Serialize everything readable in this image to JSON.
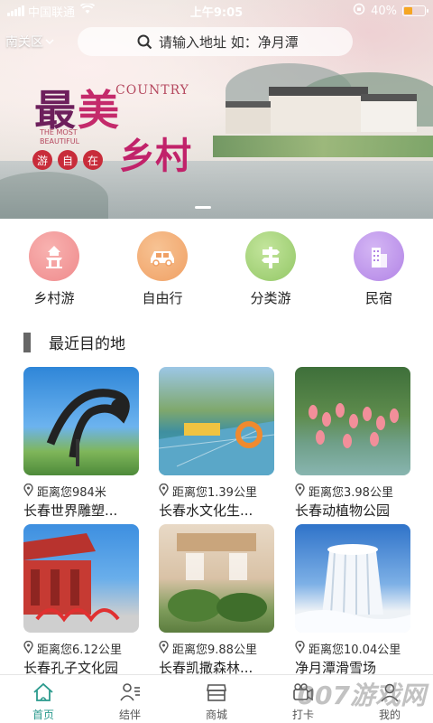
{
  "status_bar": {
    "carrier": "中国联通",
    "time": "上午9:05",
    "battery": "40%",
    "battery_level": 0.4
  },
  "header": {
    "location": "南关区",
    "search_placeholder": "请输入地址 如：净月潭"
  },
  "banner": {
    "title_part1a": "最",
    "title_part1b": "美",
    "title_part2": "乡村",
    "country_text": "COUNTRY",
    "most_beautiful_line1": "THE MOST",
    "most_beautiful_line2": "BEAUTIFUL",
    "seals": [
      "游",
      "自",
      "在"
    ]
  },
  "categories": [
    {
      "label": "乡村游",
      "icon": "temple-icon",
      "color": "#f08a8c"
    },
    {
      "label": "自由行",
      "icon": "car-icon",
      "color": "#f2a56d"
    },
    {
      "label": "分类游",
      "icon": "signpost-icon",
      "color": "#9bd06d"
    },
    {
      "label": "民宿",
      "icon": "building-icon",
      "color": "#b78ae8"
    }
  ],
  "section": {
    "title": "最近目的地"
  },
  "destinations": [
    {
      "distance": "距离您984米",
      "name": "长春世界雕塑..."
    },
    {
      "distance": "距离您1.39公里",
      "name": "长春水文化生..."
    },
    {
      "distance": "距离您3.98公里",
      "name": "长春动植物公园"
    },
    {
      "distance": "距离您6.12公里",
      "name": "长春孔子文化园"
    },
    {
      "distance": "距离您9.88公里",
      "name": "长春凯撒森林..."
    },
    {
      "distance": "距离您10.04公里",
      "name": "净月潭滑雪场"
    }
  ],
  "bottom_nav": [
    {
      "label": "首页",
      "icon": "home-icon",
      "active": true
    },
    {
      "label": "结伴",
      "icon": "companion-icon",
      "active": false
    },
    {
      "label": "商城",
      "icon": "shop-icon",
      "active": false
    },
    {
      "label": "打卡",
      "icon": "camera-icon",
      "active": false
    },
    {
      "label": "我的",
      "icon": "user-icon",
      "active": false
    }
  ],
  "watermark": "007游戏网",
  "colors": {
    "accent": "#2a9a8d",
    "section_bar": "#666666"
  }
}
